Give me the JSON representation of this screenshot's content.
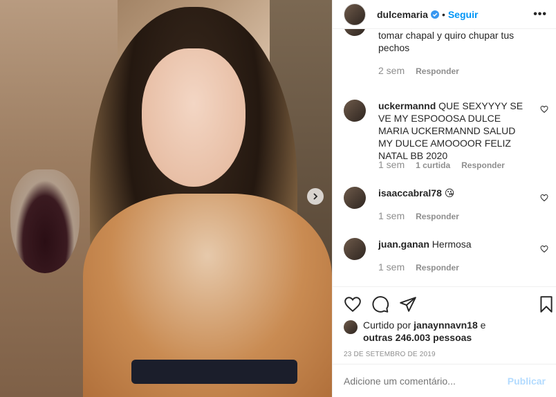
{
  "post": {
    "username": "dulcemaria",
    "follow_label": "Seguir",
    "separator": "•",
    "more_label": "•••"
  },
  "comments": [
    {
      "username": "",
      "text": "tomar chapal y quiro chupar tus pechos",
      "time": "2 sem",
      "likes": "",
      "reply": "Responder"
    },
    {
      "username": "uckermannd",
      "text": "QUE SEXYYYY SE VE MY ESPOOOSA DULCE MARIA UCKERMANND SALUD MY DULCE AMOOOOR FELIZ NATAL BB 2020",
      "time": "1 sem",
      "likes": "1 curtida",
      "reply": "Responder"
    },
    {
      "username": "isaaccabral78",
      "text": "😘",
      "time": "1 sem",
      "likes": "",
      "reply": "Responder"
    },
    {
      "username": "juan.ganan",
      "text": "Hermosa",
      "time": "1 sem",
      "likes": "",
      "reply": "Responder"
    }
  ],
  "likes": {
    "prefix": "Curtido por",
    "user": "janaynnavn18",
    "conj": "e",
    "others": "outras 246.003 pessoas"
  },
  "date": "23 DE SETEMBRO DE 2019",
  "add_comment": {
    "placeholder": "Adicione um comentário...",
    "publish": "Publicar"
  },
  "colors": {
    "accent": "#0095f6",
    "publish_disabled": "#b3dbff",
    "muted": "#8e8e8e"
  }
}
